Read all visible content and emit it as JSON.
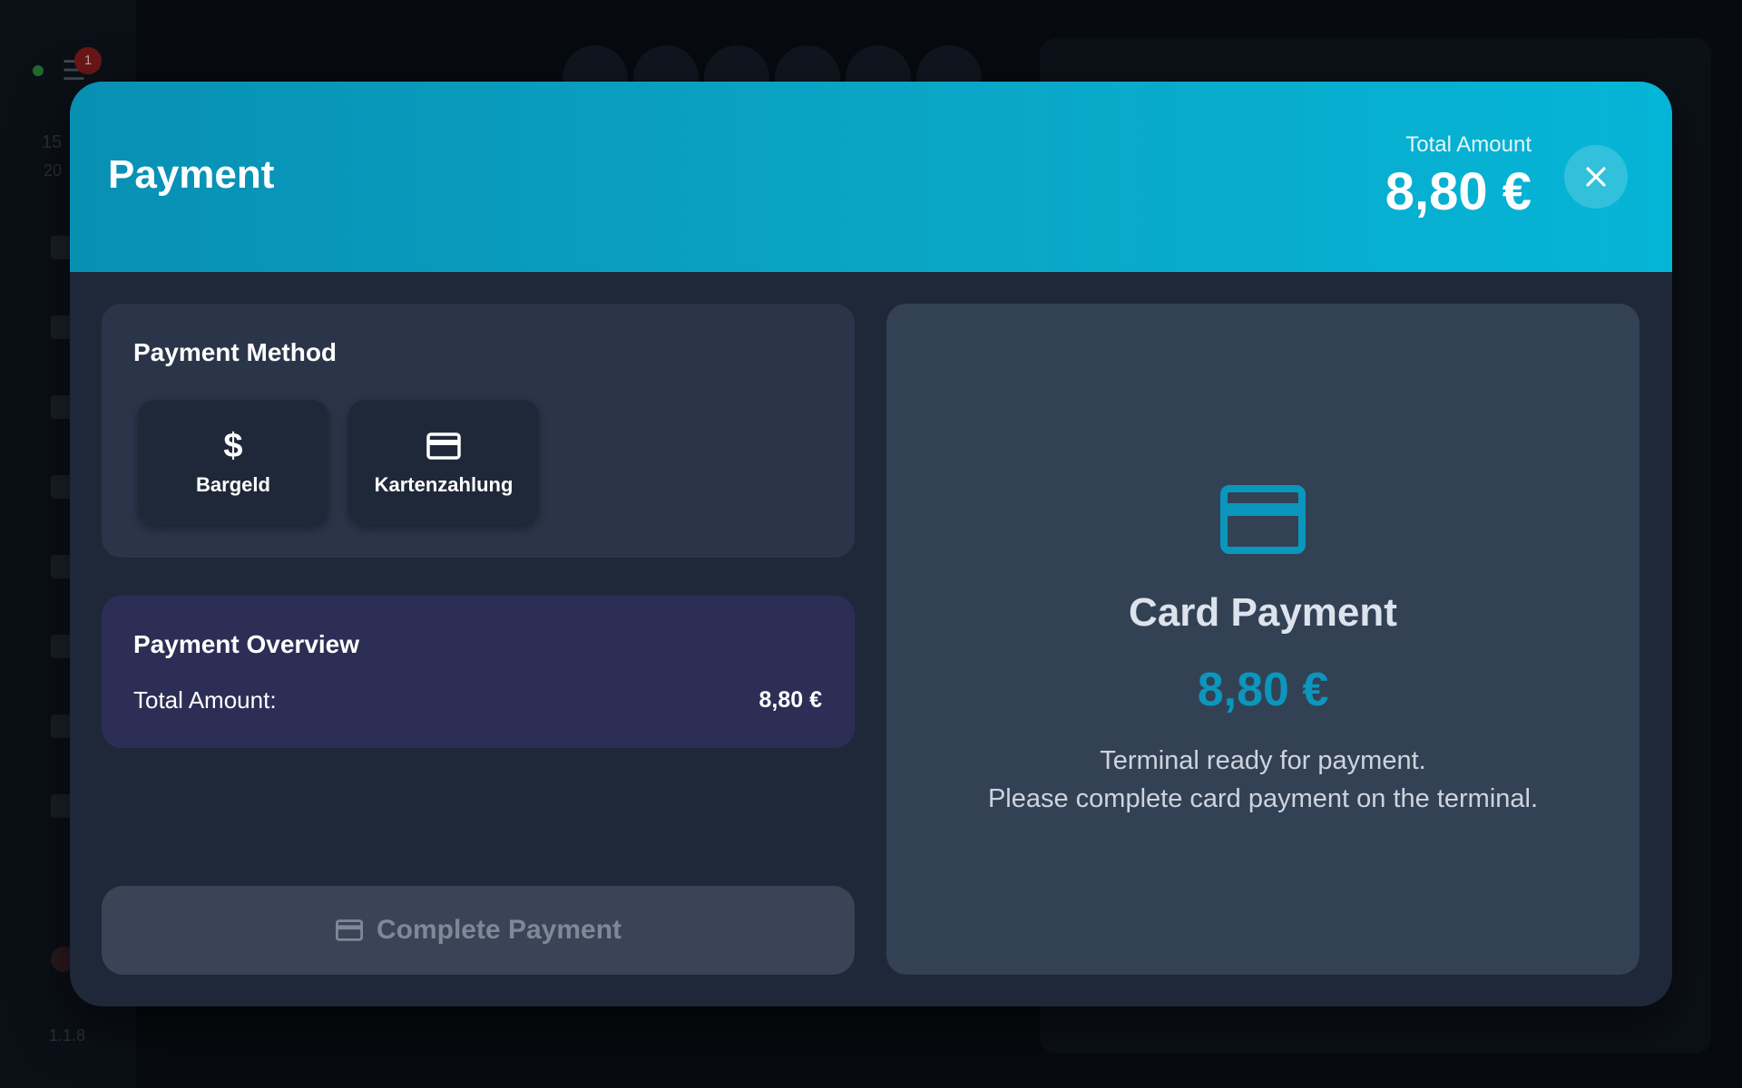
{
  "background": {
    "notification_count": "1",
    "time": "15",
    "date": "20",
    "version": "1.1.8"
  },
  "modal": {
    "title": "Payment",
    "total_label": "Total Amount",
    "total_value": "8,80 €",
    "close_icon": "close-icon"
  },
  "payment_method": {
    "title": "Payment Method",
    "options": [
      {
        "label": "Bargeld",
        "icon": "dollar-icon"
      },
      {
        "label": "Kartenzahlung",
        "icon": "credit-card-icon"
      }
    ]
  },
  "overview": {
    "title": "Payment Overview",
    "total_label": "Total Amount:",
    "total_value": "8,80 €"
  },
  "complete_button": {
    "label": "Complete Payment",
    "icon": "credit-card-icon",
    "enabled": false
  },
  "card_panel": {
    "icon": "credit-card-icon",
    "title": "Card Payment",
    "amount": "8,80 €",
    "message_line1": "Terminal ready for payment.",
    "message_line2": "Please complete card payment on the terminal."
  },
  "colors": {
    "header_start": "#0890b3",
    "header_end": "#05b5d6",
    "accent": "#0b96bd",
    "overview_bg": "#2d2e55",
    "panel_bg": "#334155"
  }
}
